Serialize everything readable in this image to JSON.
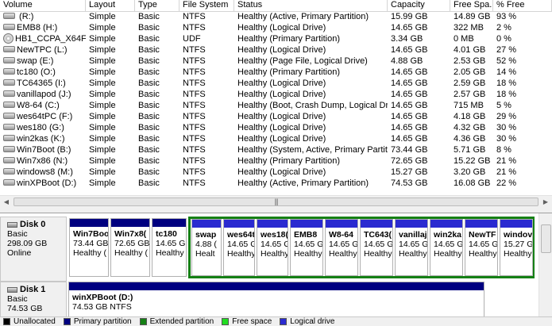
{
  "volume_list": {
    "columns": [
      "Volume",
      "Layout",
      "Type",
      "File System",
      "Status",
      "Capacity",
      "Free Spa...",
      "% Free"
    ],
    "rows": [
      {
        "icon": "drive-icon",
        "volume": " (R:)",
        "layout": "Simple",
        "type": "Basic",
        "fs": "NTFS",
        "status": "Healthy (Active, Primary Partition)",
        "capacity": "15.99 GB",
        "free": "14.89 GB",
        "pct": "93 %"
      },
      {
        "icon": "drive-icon",
        "volume": "EMB8 (H:)",
        "layout": "Simple",
        "type": "Basic",
        "fs": "NTFS",
        "status": "Healthy (Logical Drive)",
        "capacity": "14.65 GB",
        "free": "322 MB",
        "pct": "2 %"
      },
      {
        "icon": "cd-icon",
        "volume": "HB1_CCPA_X64FR...",
        "layout": "Simple",
        "type": "Basic",
        "fs": "UDF",
        "status": "Healthy (Primary Partition)",
        "capacity": "3.34 GB",
        "free": "0 MB",
        "pct": "0 %"
      },
      {
        "icon": "drive-icon",
        "volume": "NewTPC (L:)",
        "layout": "Simple",
        "type": "Basic",
        "fs": "NTFS",
        "status": "Healthy (Logical Drive)",
        "capacity": "14.65 GB",
        "free": "4.01 GB",
        "pct": "27 %"
      },
      {
        "icon": "drive-icon",
        "volume": "swap (E:)",
        "layout": "Simple",
        "type": "Basic",
        "fs": "NTFS",
        "status": "Healthy (Page File, Logical Drive)",
        "capacity": "4.88 GB",
        "free": "2.53 GB",
        "pct": "52 %"
      },
      {
        "icon": "drive-icon",
        "volume": "tc180 (O:)",
        "layout": "Simple",
        "type": "Basic",
        "fs": "NTFS",
        "status": "Healthy (Primary Partition)",
        "capacity": "14.65 GB",
        "free": "2.05 GB",
        "pct": "14 %"
      },
      {
        "icon": "drive-icon",
        "volume": "TC64365 (I:)",
        "layout": "Simple",
        "type": "Basic",
        "fs": "NTFS",
        "status": "Healthy (Logical Drive)",
        "capacity": "14.65 GB",
        "free": "2.59 GB",
        "pct": "18 %"
      },
      {
        "icon": "drive-icon",
        "volume": "vanillapod (J:)",
        "layout": "Simple",
        "type": "Basic",
        "fs": "NTFS",
        "status": "Healthy (Logical Drive)",
        "capacity": "14.65 GB",
        "free": "2.57 GB",
        "pct": "18 %"
      },
      {
        "icon": "drive-icon",
        "volume": "W8-64 (C:)",
        "layout": "Simple",
        "type": "Basic",
        "fs": "NTFS",
        "status": "Healthy (Boot, Crash Dump, Logical Drive)",
        "capacity": "14.65 GB",
        "free": "715 MB",
        "pct": "5 %"
      },
      {
        "icon": "drive-icon",
        "volume": "wes64tPC (F:)",
        "layout": "Simple",
        "type": "Basic",
        "fs": "NTFS",
        "status": "Healthy (Logical Drive)",
        "capacity": "14.65 GB",
        "free": "4.18 GB",
        "pct": "29 %"
      },
      {
        "icon": "drive-icon",
        "volume": "wes180 (G:)",
        "layout": "Simple",
        "type": "Basic",
        "fs": "NTFS",
        "status": "Healthy (Logical Drive)",
        "capacity": "14.65 GB",
        "free": "4.32 GB",
        "pct": "30 %"
      },
      {
        "icon": "drive-icon",
        "volume": "win2kas (K:)",
        "layout": "Simple",
        "type": "Basic",
        "fs": "NTFS",
        "status": "Healthy (Logical Drive)",
        "capacity": "14.65 GB",
        "free": "4.36 GB",
        "pct": "30 %"
      },
      {
        "icon": "drive-icon",
        "volume": "Win7Boot (B:)",
        "layout": "Simple",
        "type": "Basic",
        "fs": "NTFS",
        "status": "Healthy (System, Active, Primary Partition)",
        "capacity": "73.44 GB",
        "free": "5.71 GB",
        "pct": "8 %"
      },
      {
        "icon": "drive-icon",
        "volume": "Win7x86 (N:)",
        "layout": "Simple",
        "type": "Basic",
        "fs": "NTFS",
        "status": "Healthy (Primary Partition)",
        "capacity": "72.65 GB",
        "free": "15.22 GB",
        "pct": "21 %"
      },
      {
        "icon": "drive-icon",
        "volume": "windows8 (M:)",
        "layout": "Simple",
        "type": "Basic",
        "fs": "NTFS",
        "status": "Healthy (Logical Drive)",
        "capacity": "15.27 GB",
        "free": "3.20 GB",
        "pct": "21 %"
      },
      {
        "icon": "drive-icon",
        "volume": "winXPBoot (D:)",
        "layout": "Simple",
        "type": "Basic",
        "fs": "NTFS",
        "status": "Healthy (Active, Primary Partition)",
        "capacity": "74.53 GB",
        "free": "16.08 GB",
        "pct": "22 %"
      }
    ]
  },
  "hscroll": {
    "left_arrow": "◀",
    "right_arrow": "▶",
    "grip": "|||"
  },
  "disks": [
    {
      "name": "Disk 0",
      "type": "Basic",
      "size": "298.09 GB",
      "status": "Online",
      "partitions": [
        {
          "name": "Win7Boo",
          "size": "73.44 GB",
          "status": "Healthy (",
          "kind": "primary"
        },
        {
          "name": "Win7x8(",
          "size": "72.65 GB",
          "status": "Healthy (",
          "kind": "primary"
        },
        {
          "name": "tc180",
          "size": "14.65 G",
          "status": "Healthy",
          "kind": "primary"
        },
        {
          "name": "swap",
          "size": "4.88 (",
          "status": "Healt",
          "kind": "logical"
        },
        {
          "name": "wes64t",
          "size": "14.65 G",
          "status": "Healthy",
          "kind": "logical"
        },
        {
          "name": "wes18(",
          "size": "14.65 G",
          "status": "Healthy",
          "kind": "logical"
        },
        {
          "name": "EMB8",
          "size": "14.65 G",
          "status": "Healthy",
          "kind": "logical"
        },
        {
          "name": "W8-64",
          "size": "14.65 G",
          "status": "Healthy",
          "kind": "logical"
        },
        {
          "name": "TC643(",
          "size": "14.65 G",
          "status": "Healthy",
          "kind": "logical"
        },
        {
          "name": "vanillaj",
          "size": "14.65 G",
          "status": "Healthy",
          "kind": "logical"
        },
        {
          "name": "win2ka",
          "size": "14.65 G",
          "status": "Healthy",
          "kind": "logical"
        },
        {
          "name": "NewTF",
          "size": "14.65 G",
          "status": "Healthy",
          "kind": "logical"
        },
        {
          "name": "windov",
          "size": "15.27 G",
          "status": "Healthy",
          "kind": "logical"
        }
      ]
    },
    {
      "name": "Disk 1",
      "type": "Basic",
      "size": "74.53 GB",
      "status": "",
      "partitions": [
        {
          "name": "winXPBoot  (D:)",
          "size": "74.53 GB NTFS",
          "status": "",
          "kind": "primary"
        }
      ]
    }
  ],
  "legend": [
    {
      "label": "Unallocated",
      "color": "#000000"
    },
    {
      "label": "Primary partition",
      "color": "#000080"
    },
    {
      "label": "Extended partition",
      "color": "#158015"
    },
    {
      "label": "Free space",
      "color": "#22dd22"
    },
    {
      "label": "Logical drive",
      "color": "#2a2ad0"
    }
  ]
}
